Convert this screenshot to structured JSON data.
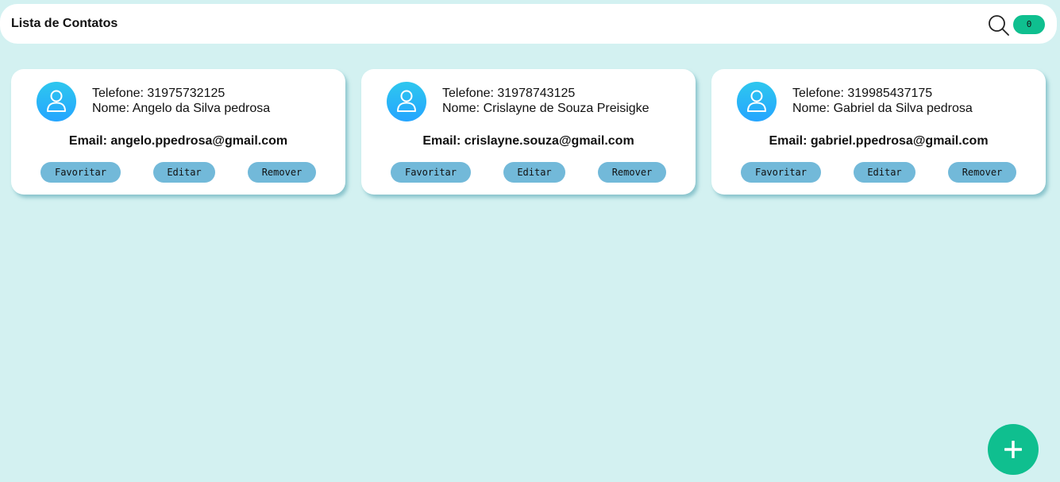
{
  "header": {
    "title": "Lista de Contatos",
    "search_icon": "search-icon",
    "counter": "0"
  },
  "contacts": [
    {
      "phone": "Telefone: 31975732125",
      "name": "Nome: Angelo da Silva pedrosa",
      "email": "Email: angelo.ppedrosa@gmail.com",
      "favorite_label": "Favoritar",
      "edit_label": "Editar",
      "remove_label": "Remover"
    },
    {
      "phone": "Telefone: 31978743125",
      "name": "Nome: Crislayne de Souza Preisigke",
      "email": "Email: crislayne.souza@gmail.com",
      "favorite_label": "Favoritar",
      "edit_label": "Editar",
      "remove_label": "Remover"
    },
    {
      "phone": "Telefone: 319985437175",
      "name": "Nome: Gabriel da Silva pedrosa",
      "email": "Email: gabriel.ppedrosa@gmail.com",
      "favorite_label": "Favoritar",
      "edit_label": "Editar",
      "remove_label": "Remover"
    }
  ],
  "fab": {
    "icon": "plus-icon"
  },
  "colors": {
    "background": "#d3f1f1",
    "accent_green": "#0fbf8f",
    "button_blue": "#72b9d9",
    "avatar_blue": "#25a5ff"
  }
}
